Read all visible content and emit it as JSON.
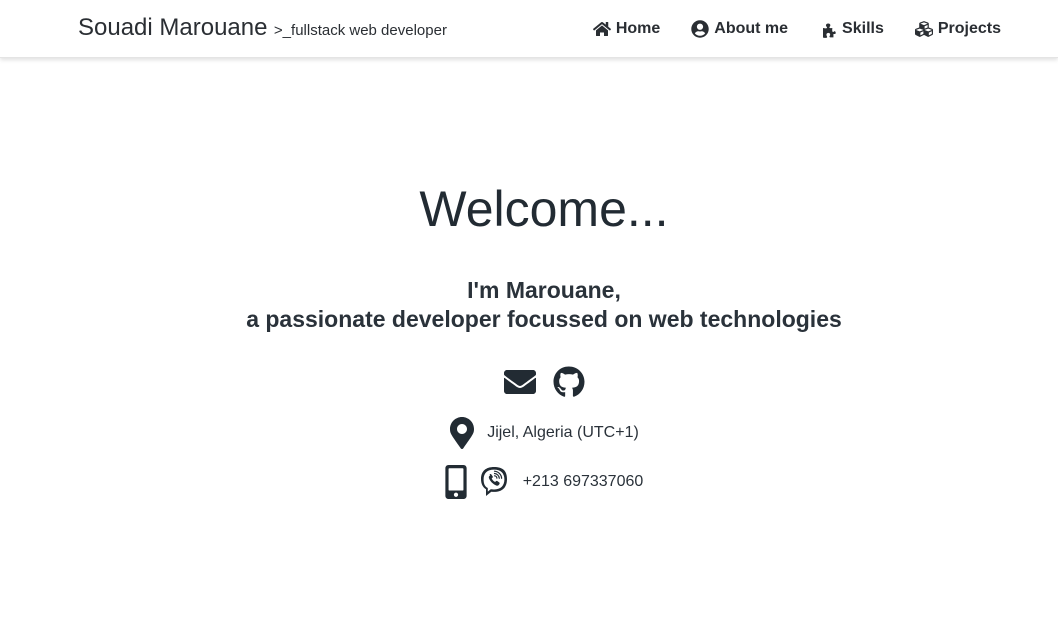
{
  "header": {
    "brand_name": "Souadi Marouane",
    "brand_sub": ">_fullstack web developer",
    "nav": [
      {
        "label": "Home",
        "icon": "home-icon"
      },
      {
        "label": "About me",
        "icon": "user-circle-icon"
      },
      {
        "label": "Skills",
        "icon": "puzzle-icon"
      },
      {
        "label": "Projects",
        "icon": "cubes-icon"
      }
    ]
  },
  "hero": {
    "title": "Welcome...",
    "intro_line1": "I'm Marouane,",
    "intro_line2": "a passionate developer focussed on web technologies",
    "social": [
      {
        "icon": "envelope-icon"
      },
      {
        "icon": "github-icon"
      }
    ],
    "location": "Jijel, Algeria (UTC+1)",
    "phone": "+213 697337060"
  },
  "colors": {
    "text": "#222b33",
    "background": "#ffffff"
  }
}
